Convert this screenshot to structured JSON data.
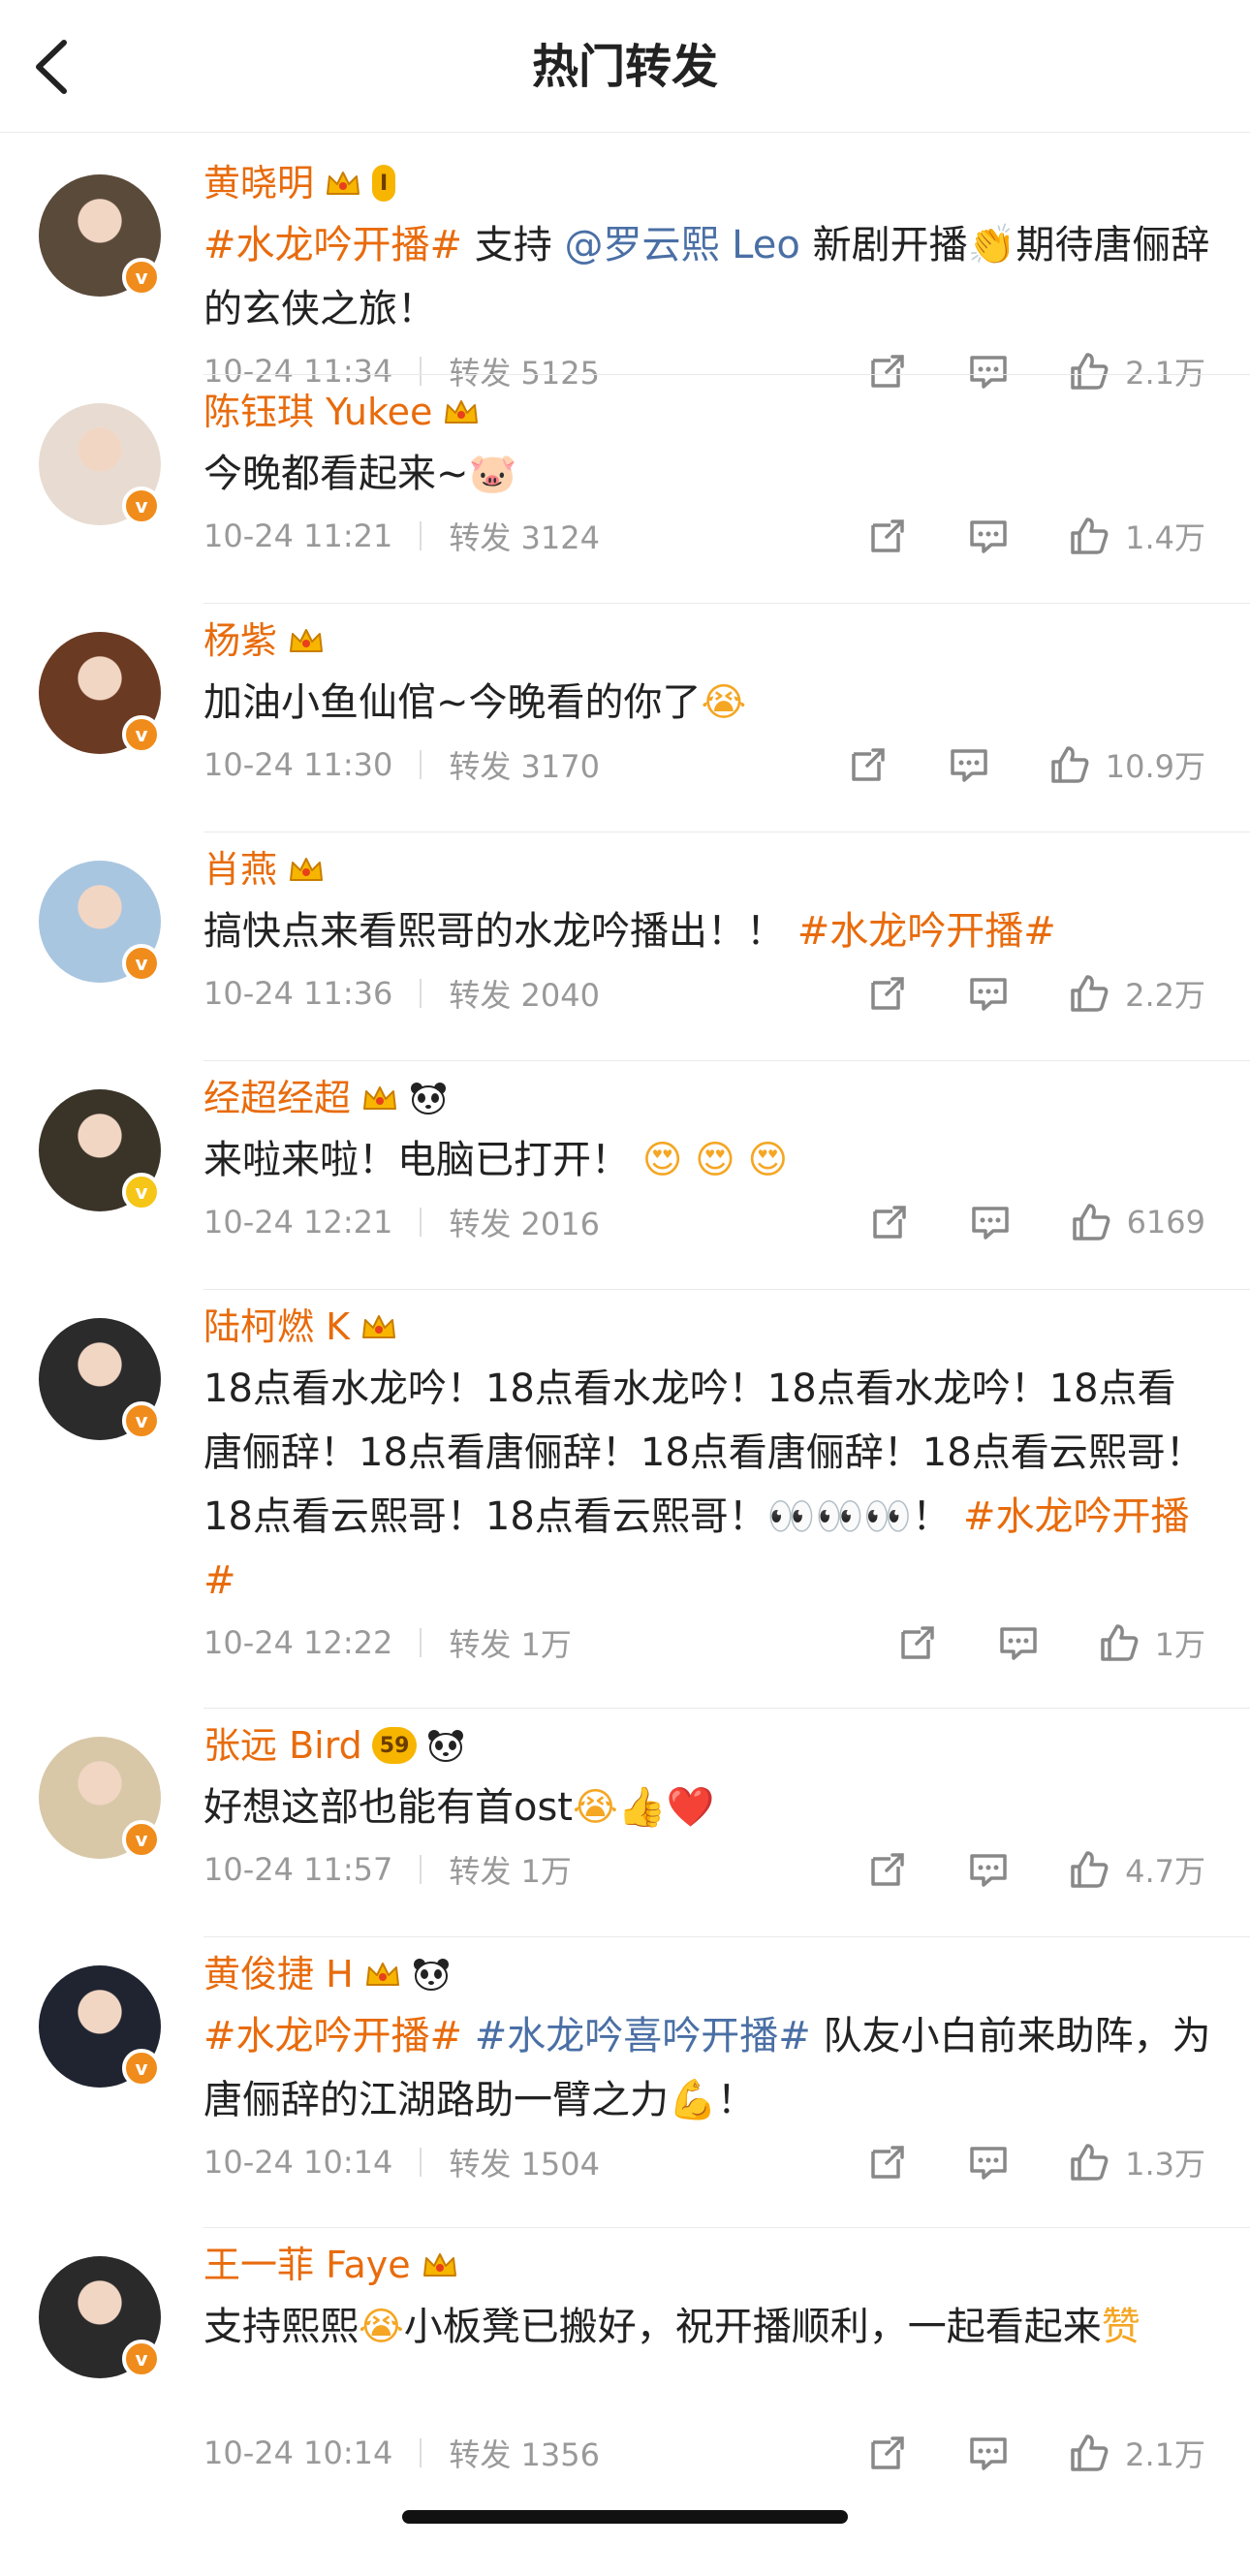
{
  "header": {
    "title": "热门转发"
  },
  "labels": {
    "repost_prefix": "转发"
  },
  "colors": {
    "accent": "#e86b0c",
    "mention": "#4a6fa5",
    "meta": "#999999"
  },
  "posts": [
    {
      "name": "黄晓明",
      "badges": [
        "crown-level-I"
      ],
      "level_text": "I",
      "segments": [
        {
          "t": "tag",
          "v": "#水龙吟开播#"
        },
        {
          "t": "txt",
          "v": " 支持 "
        },
        {
          "t": "mention",
          "v": "@罗云熙 Leo"
        },
        {
          "t": "txt",
          "v": " 新剧开播"
        },
        {
          "t": "emoji",
          "v": "👏"
        },
        {
          "t": "txt",
          "v": "期待唐俪辞的玄侠之旅！"
        }
      ],
      "time": "10-24 11:34",
      "reposts": "5125",
      "likes": "2.1万",
      "vcolor": "#f08c1b",
      "avatar_bg": "#5a4a3a"
    },
    {
      "name": "陈钰琪 Yukee",
      "badges": [
        "crown"
      ],
      "segments": [
        {
          "t": "txt",
          "v": "今晚都看起来~"
        },
        {
          "t": "emoji",
          "v": "🐷"
        }
      ],
      "time": "10-24 11:21",
      "reposts": "3124",
      "likes": "1.4万",
      "vcolor": "#f08c1b",
      "avatar_bg": "#e8dcd2"
    },
    {
      "name": "杨紫",
      "badges": [
        "crown"
      ],
      "segments": [
        {
          "t": "txt",
          "v": "加油小鱼仙倌~今晚看的你了"
        },
        {
          "t": "emoji",
          "v": "😭"
        }
      ],
      "time": "10-24 11:30",
      "reposts": "3170",
      "likes": "10.9万",
      "vcolor": "#f08c1b",
      "avatar_bg": "#6b3a22"
    },
    {
      "name": "肖燕",
      "badges": [
        "crown"
      ],
      "segments": [
        {
          "t": "txt",
          "v": "搞快点来看熙哥的水龙吟播出！！ "
        },
        {
          "t": "tag",
          "v": "#水龙吟开播#"
        }
      ],
      "time": "10-24 11:36",
      "reposts": "2040",
      "likes": "2.2万",
      "vcolor": "#f08c1b",
      "avatar_bg": "#a9c6e0"
    },
    {
      "name": "经超经超",
      "badges": [
        "crown",
        "panda"
      ],
      "segments": [
        {
          "t": "txt",
          "v": "来啦来啦！电脑已打开！ "
        },
        {
          "t": "emoji",
          "v": "😍 😍 😍"
        }
      ],
      "time": "10-24 12:21",
      "reposts": "2016",
      "likes": "6169",
      "vcolor": "#f5c518",
      "avatar_bg": "#3a3328"
    },
    {
      "name": "陆柯燃 K",
      "badges": [
        "crown"
      ],
      "segments": [
        {
          "t": "txt",
          "v": "18点看水龙吟！18点看水龙吟！18点看水龙吟！18点看唐俪辞！18点看唐俪辞！18点看唐俪辞！18点看云熙哥！18点看云熙哥！18点看云熙哥！"
        },
        {
          "t": "emoji",
          "v": "👀👀👀"
        },
        {
          "t": "txt",
          "v": "！ "
        },
        {
          "t": "tag",
          "v": "#水龙吟开播#"
        }
      ],
      "time": "10-24 12:22",
      "reposts": "1万",
      "likes": "1万",
      "vcolor": "#f08c1b",
      "avatar_bg": "#2b2b2b"
    },
    {
      "name": "张远 Bird",
      "badges": [
        "level-59",
        "panda"
      ],
      "level_text": "59",
      "segments": [
        {
          "t": "txt",
          "v": "好想这部也能有首ost"
        },
        {
          "t": "emoji",
          "v": "😭👍❤️"
        }
      ],
      "time": "10-24 11:57",
      "reposts": "1万",
      "likes": "4.7万",
      "vcolor": "#f08c1b",
      "avatar_bg": "#d8c8a8"
    },
    {
      "name": "黄俊捷 H",
      "badges": [
        "crown",
        "panda"
      ],
      "segments": [
        {
          "t": "tag",
          "v": "#水龙吟开播#"
        },
        {
          "t": "txt",
          "v": " "
        },
        {
          "t": "mention",
          "v": "#水龙吟喜吟开播#"
        },
        {
          "t": "txt",
          "v": " 队友小白前来助阵，为唐俪辞的江湖路助一臂之力"
        },
        {
          "t": "emoji",
          "v": "💪"
        },
        {
          "t": "txt",
          "v": "！"
        }
      ],
      "time": "10-24 10:14",
      "reposts": "1504",
      "likes": "1.3万",
      "vcolor": "#f08c1b",
      "avatar_bg": "#1f2430"
    },
    {
      "name": "王一菲 Faye",
      "badges": [
        "crown"
      ],
      "segments": [
        {
          "t": "txt",
          "v": "支持熙熙"
        },
        {
          "t": "emoji",
          "v": "😭"
        },
        {
          "t": "txt",
          "v": "小板凳已搬好，祝开播顺利，一起看起来"
        },
        {
          "t": "emoji",
          "v": "赞"
        }
      ],
      "time": "10-24 10:14",
      "reposts": "1356",
      "likes": "2.1万",
      "vcolor": "#f08c1b",
      "avatar_bg": "#2a2a2a"
    }
  ]
}
